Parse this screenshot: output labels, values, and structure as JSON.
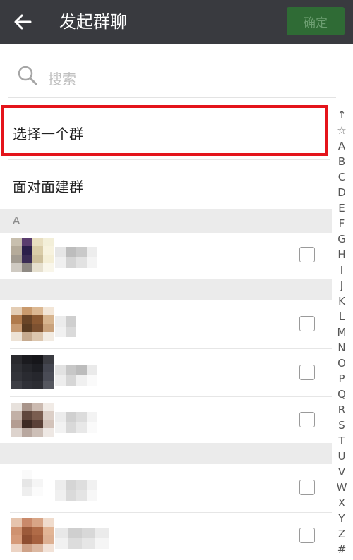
{
  "header": {
    "title": "发起群聊",
    "confirm_label": "确定"
  },
  "search": {
    "placeholder": "搜索"
  },
  "options": {
    "select_group": "选择一个群",
    "face_to_face": "面对面建群"
  },
  "section": {
    "letter": "A"
  },
  "index_bar": [
    "↑",
    "☆",
    "A",
    "B",
    "C",
    "D",
    "E",
    "F",
    "G",
    "H",
    "I",
    "J",
    "K",
    "L",
    "M",
    "N",
    "O",
    "P",
    "Q",
    "R",
    "S",
    "T",
    "U",
    "V",
    "W",
    "X",
    "Y",
    "Z",
    "#"
  ],
  "colors": {
    "topbar": "#393a3f",
    "confirm_bg": "#2f6b35",
    "highlight_border": "#e4141b",
    "section_bg": "#ebebeb"
  }
}
